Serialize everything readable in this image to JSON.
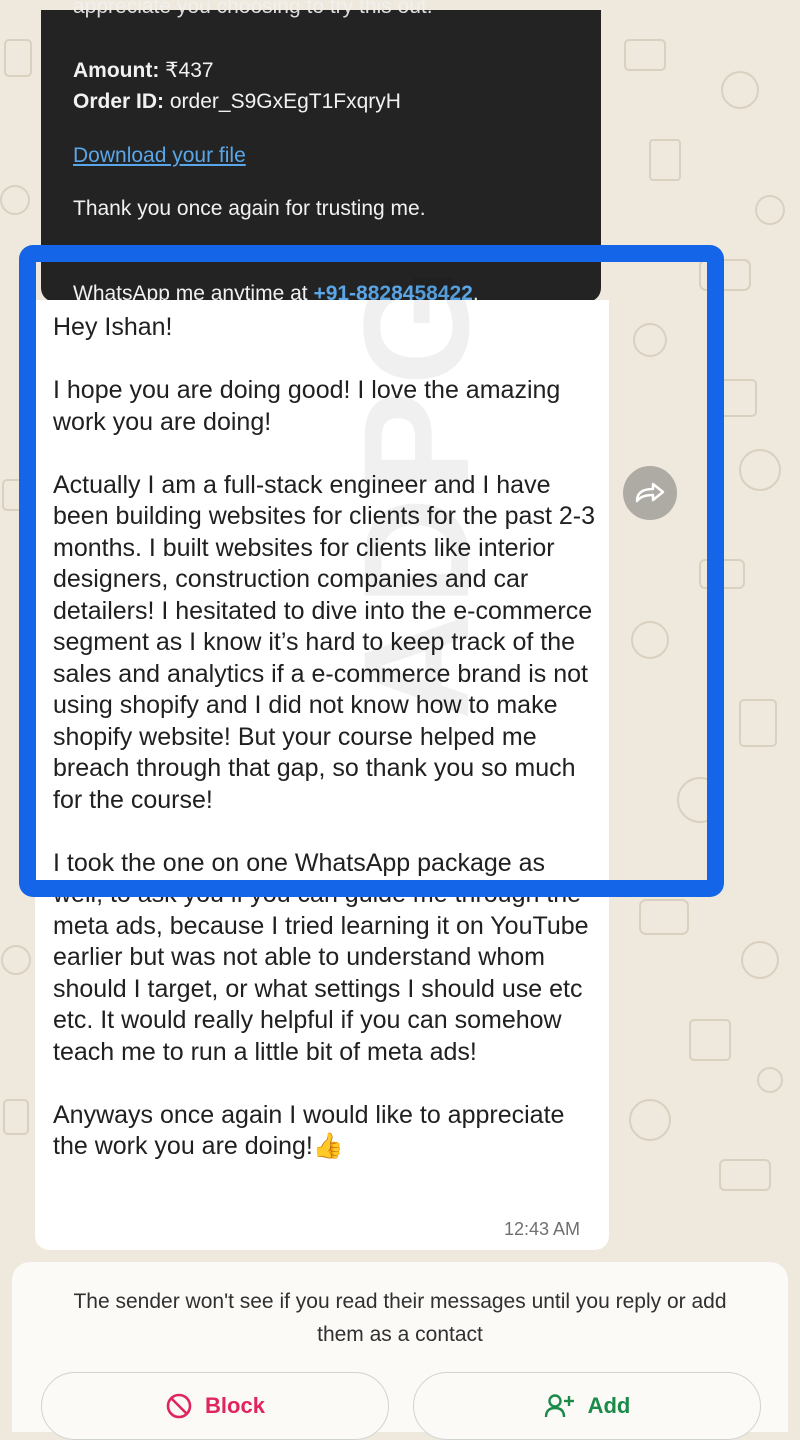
{
  "quoted": {
    "cut_line": "appreciate you choosing to try this out.",
    "amount_label": "Amount:",
    "amount_value": "₹437",
    "order_label": "Order ID:",
    "order_value": "order_S9GxEgT1FxqryH",
    "download_link": "Download your file",
    "thanks": "Thank you once again for trusting me.",
    "whatsapp_prefix": "WhatsApp me anytime at ",
    "phone": "+91-8828458422",
    "whatsapp_suffix": "."
  },
  "message": {
    "greeting": "Hey Ishan!",
    "para1": "I hope you are doing good! I love the amazing work you are doing!",
    "para2": "Actually I am a full-stack engineer and I have been building websites for clients for the past 2-3 months. I built websites for clients like interior designers, construction companies and car detailers! I hesitated to dive into the e-commerce segment as I know it’s hard to keep track of the sales and analytics if a e-commerce brand is not using shopify and I did not know how to make shopify website! But your course helped me breach through that gap, so thank you so much for the course!",
    "para3": "I took the one on one WhatsApp package as well, to ask you if you can guide me through the meta ads, because I tried learning it on YouTube earlier but was not able to understand whom should I target, or what settings I should use etc etc. It would really helpful if you can somehow teach me to run a little bit of meta ads!",
    "para4": "Anyways once again I would like to appreciate the work you are doing!",
    "emoji": "👍",
    "time": "12:43 AM"
  },
  "notice": {
    "text": "The sender won't see if you read their messages until you reply or add them as a contact",
    "block_label": "Block",
    "add_label": "Add"
  },
  "colors": {
    "highlight": "#1565e8",
    "link": "#5aa6e8",
    "block": "#e0245e",
    "add": "#1b8a48"
  },
  "icons": [
    "forward-icon",
    "block-icon",
    "add-contact-icon"
  ]
}
